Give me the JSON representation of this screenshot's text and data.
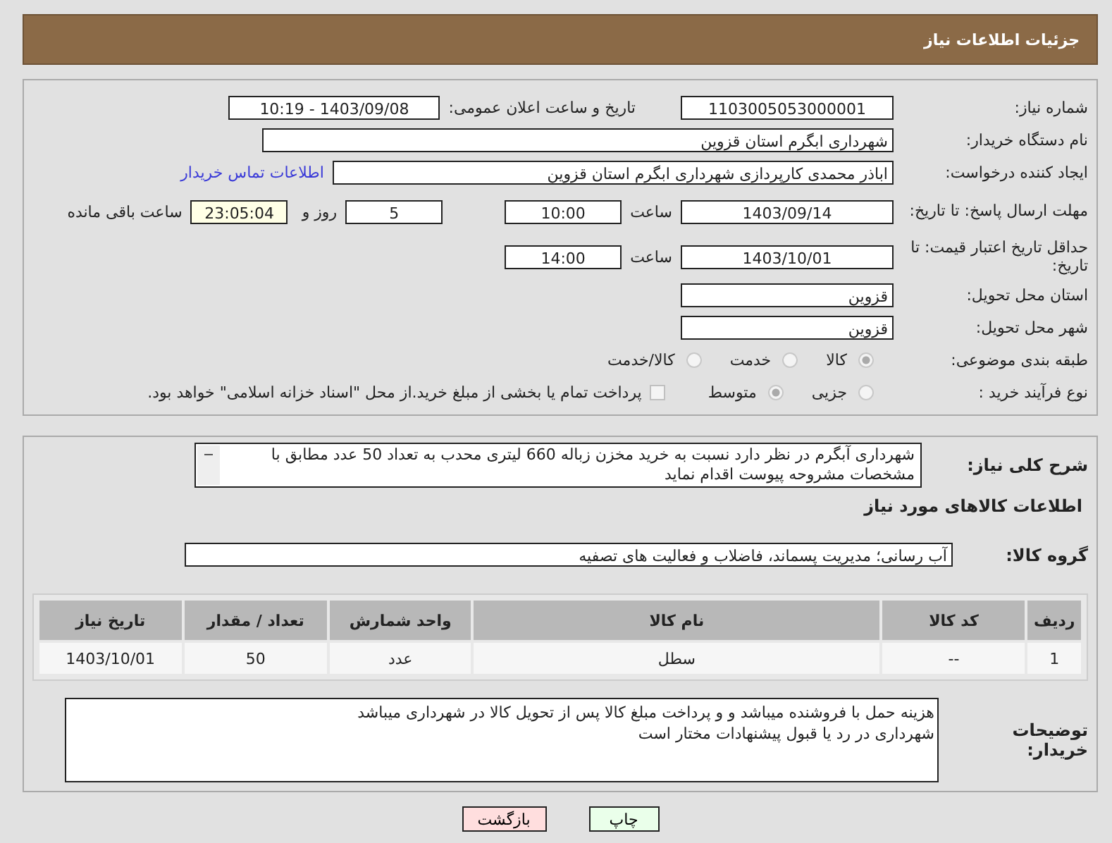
{
  "header": {
    "title": "جزئیات اطلاعات نیاز"
  },
  "need_number": {
    "label": "شماره نیاز:",
    "value": "1103005053000001"
  },
  "announcement": {
    "label": "تاریخ و ساعت اعلان عمومی:",
    "value": "1403/09/08 - 10:19"
  },
  "buyer_org": {
    "label": "نام دستگاه خریدار:",
    "value": "شهرداری ابگرم استان قزوین"
  },
  "requester": {
    "label": "ایجاد کننده درخواست:",
    "value": "اباذر محمدی کارپردازی شهرداری ابگرم استان قزوین",
    "contact_link": "اطلاعات تماس خریدار"
  },
  "reply_deadline": {
    "label": "مهلت ارسال پاسخ: تا تاریخ:",
    "date": "1403/09/14",
    "time_label": "ساعت",
    "time": "10:00",
    "days": "5",
    "days_label": "روز و",
    "remaining": "23:05:04",
    "remaining_label": "ساعت باقی مانده"
  },
  "price_validity": {
    "label": "حداقل تاریخ اعتبار قیمت: تا تاریخ:",
    "date": "1403/10/01",
    "time_label": "ساعت",
    "time": "14:00"
  },
  "delivery_province": {
    "label": "استان محل تحویل:",
    "value": "قزوین"
  },
  "delivery_city": {
    "label": "شهر محل تحویل:",
    "value": "قزوین"
  },
  "category": {
    "label": "طبقه بندی موضوعی:",
    "options": [
      {
        "label": "کالا",
        "selected": true
      },
      {
        "label": "خدمت",
        "selected": false
      },
      {
        "label": "کالا/خدمت",
        "selected": false
      }
    ]
  },
  "purchase_type": {
    "label": "نوع فرآیند خرید :",
    "options": [
      {
        "label": "جزیی",
        "selected": false
      },
      {
        "label": "متوسط",
        "selected": true
      }
    ],
    "treasury": {
      "label": "پرداخت تمام یا بخشی از مبلغ خرید.از محل \"اسناد خزانه اسلامی\" خواهد بود.",
      "checked": false
    }
  },
  "description": {
    "label": "شرح کلی نیاز:",
    "value": "شهرداری آبگرم در نظر دارد نسبت به خرید مخزن زباله 660 لیتری محدب به تعداد 50 عدد مطابق با مشخصات مشروحه پیوست اقدام نماید"
  },
  "goods_heading": "اطلاعات کالاهای مورد نیاز",
  "goods_group": {
    "label": "گروه کالا:",
    "value": "آب رسانی؛ مدیریت پسماند، فاضلاب و فعالیت های تصفیه"
  },
  "table": {
    "columns": [
      "ردیف",
      "کد کالا",
      "نام کالا",
      "واحد شمارش",
      "تعداد / مقدار",
      "تاریخ نیاز"
    ],
    "rows": [
      [
        "1",
        "--",
        "سطل",
        "عدد",
        "50",
        "1403/10/01"
      ]
    ]
  },
  "buyer_notes": {
    "label": "توضیحات خریدار:",
    "lines": [
      "هزینه حمل با فروشنده میباشد و و پرداخت مبلغ کالا پس از تحویل کالا در شهرداری میباشد",
      "شهرداری در رد یا قبول پیشنهادات مختار است"
    ]
  },
  "buttons": [
    {
      "label": "چاپ",
      "kind": "print"
    },
    {
      "label": "بازگشت",
      "kind": "back"
    }
  ]
}
